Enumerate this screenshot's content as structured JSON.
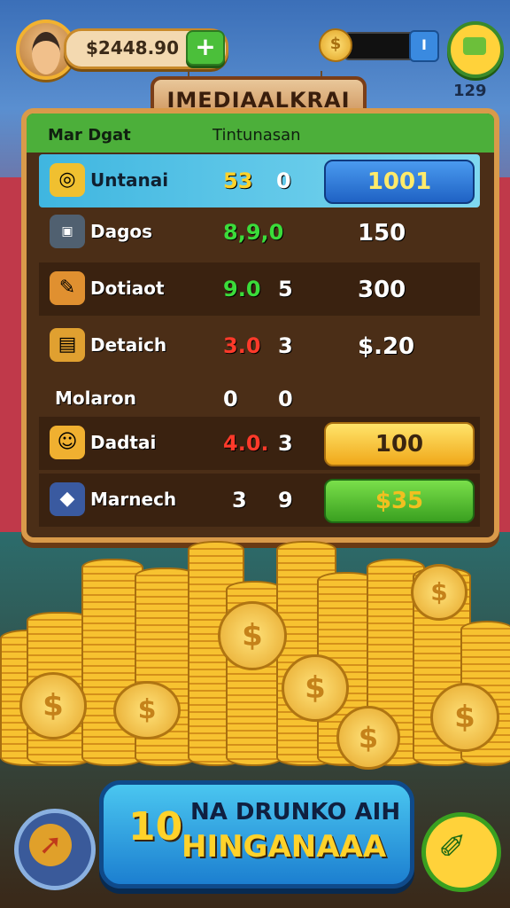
{
  "header": {
    "money": "$2448.90",
    "add_label": "+",
    "coin_symbol": "$",
    "progress_knob": "I",
    "level": "129"
  },
  "title": "IMEDIAALKRAI",
  "panel": {
    "header_left": "Mar Dgat",
    "header_right": "Tintunasan",
    "rows": [
      {
        "name": "Untanai",
        "v1": "53",
        "v1_color": "yellow",
        "v2": "0",
        "v2_color": "red",
        "button": "1001",
        "button_style": "blue"
      },
      {
        "name": "Dagos",
        "v1": "8,9,0",
        "v1_color": "green",
        "v2": "",
        "v3": "150"
      },
      {
        "name": "Dotiaot",
        "v1": "9.0",
        "v1_color": "green",
        "v2": "5",
        "v3": "300"
      },
      {
        "name": "Detaich",
        "v1": "3.0",
        "v1_color": "red",
        "v2": "3",
        "v3": "$.20"
      },
      {
        "name": "Molaron",
        "v1": "0",
        "v1_color": "white",
        "v2": "0",
        "v3": ""
      },
      {
        "name": "Dadtai",
        "v1": "4.0.",
        "v1_color": "red",
        "v2": "3",
        "button": "100",
        "button_style": "yellow"
      },
      {
        "name": "Marnech",
        "v1": "3",
        "v1_color": "white",
        "v2": "9",
        "button": "$35",
        "button_style": "green"
      }
    ]
  },
  "bottom": {
    "number": "10",
    "line1": "NA DRUNKO AIH",
    "line2": "HINGANAAA"
  },
  "icons": {
    "avatar": "player-avatar",
    "chat": "chat-icon",
    "settings": "arrow-icon",
    "tools": "pencil-icon"
  }
}
